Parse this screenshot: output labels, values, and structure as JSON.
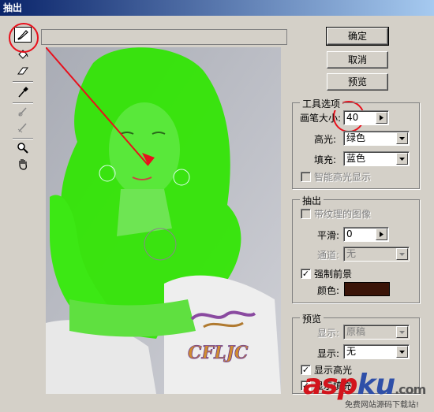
{
  "window": {
    "title": "抽出"
  },
  "tools": [
    {
      "icon": "edge-highlighter-icon"
    },
    {
      "icon": "fill-bucket-icon"
    },
    {
      "icon": "eraser-icon"
    },
    {
      "icon": "eyedropper-icon"
    },
    {
      "icon": "cleanup-tool-icon"
    },
    {
      "icon": "edge-touchup-icon"
    },
    {
      "icon": "zoom-icon"
    },
    {
      "icon": "hand-icon"
    }
  ],
  "buttons": {
    "ok": "确定",
    "cancel": "取消",
    "preview": "预览"
  },
  "tool_options": {
    "title": "工具选项",
    "brush_size_label": "画笔大小:",
    "brush_size_value": "40",
    "highlight_label": "高光:",
    "highlight_value": "绿色",
    "fill_label": "填充:",
    "fill_value": "蓝色",
    "smart_highlight_label": "智能高光显示",
    "smart_highlight_checked": false
  },
  "extraction": {
    "title": "抽出",
    "textured_label": "带纹理的图像",
    "textured_checked": false,
    "smooth_label": "平滑:",
    "smooth_value": "0",
    "channel_label": "通道:",
    "channel_value": "无",
    "force_foreground_label": "强制前景",
    "force_foreground_checked": true,
    "color_label": "颜色:",
    "color_value": "#3a1408"
  },
  "preview_group": {
    "title": "预览",
    "show_label_1": "显示:",
    "show_value_1": "原稿",
    "show_label_2": "显示:",
    "show_value_2": "无",
    "show_highlight_label": "显示高光",
    "show_highlight_checked": true,
    "show_fill_label": "显示填充",
    "show_fill_checked": true
  },
  "canvas": {
    "watermark_text": "CFLJC"
  },
  "watermark": {
    "asp": "asp",
    "ku": "ku",
    "com": ".com",
    "sub": "免费网站源码下载站!"
  },
  "colors": {
    "highlight_green": "#2fe600",
    "annotation_red": "#e8101c",
    "asp_red": "#d2141c",
    "ku_blue": "#2e4fa8"
  }
}
